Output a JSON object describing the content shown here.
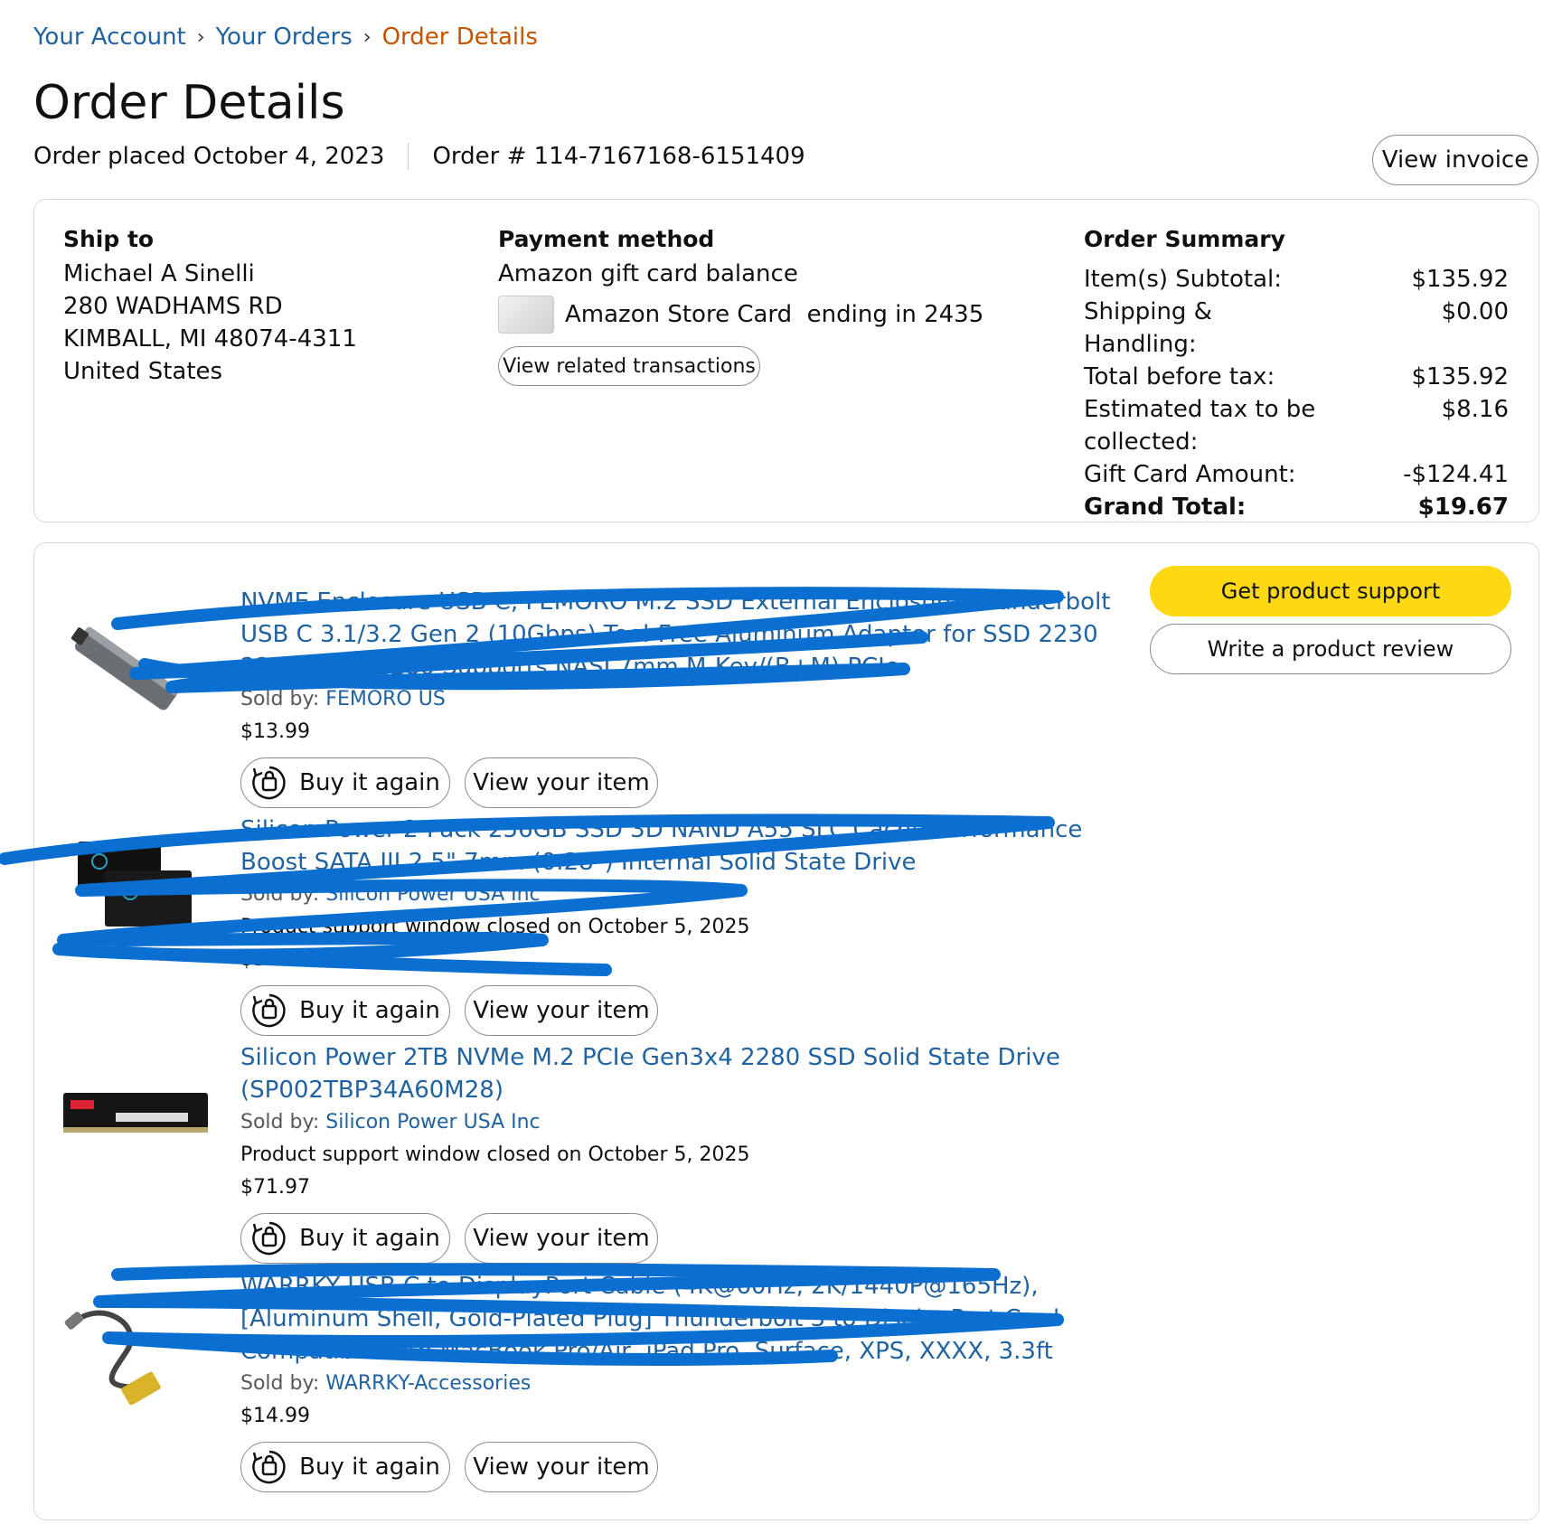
{
  "breadcrumb": {
    "items": [
      "Your Account",
      "Your Orders"
    ],
    "current": "Order Details",
    "separator": "›"
  },
  "page_title": "Order Details",
  "order_meta": {
    "placed": "Order placed October 4, 2023",
    "number": "Order # 114-7167168-6151409"
  },
  "view_invoice_label": "View invoice",
  "ship_to": {
    "heading": "Ship to",
    "lines": [
      "Michael A Sinelli",
      "280 WADHAMS RD",
      "KIMBALL, MI 48074-4311",
      "United States"
    ]
  },
  "payment": {
    "heading": "Payment method",
    "line1": "Amazon gift card balance",
    "card_text": "Amazon Store Card  ending in 2435",
    "related_label": "View related transactions"
  },
  "summary": {
    "heading": "Order Summary",
    "rows": [
      {
        "label": "Item(s) Subtotal:",
        "value": "$135.92"
      },
      {
        "label": "Shipping & Handling:",
        "value": "$0.00"
      },
      {
        "label": "Total before tax:",
        "value": "$135.92"
      },
      {
        "label": "Estimated tax to be collected:",
        "value": "$8.16"
      },
      {
        "label": "Gift Card Amount:",
        "value": "-$124.41"
      }
    ],
    "grand_label": "Grand Total:",
    "grand_value": "$19.67"
  },
  "actions": {
    "support": "Get product support",
    "review": "Write a product review"
  },
  "items": [
    {
      "title": "NVME Enclosure USB C, FEMORO M.2 SSD External Enclosure Thunderbolt USB C 3.1/3.2 Gen 2 (10Gbps) Tool-Free Aluminum Adapter for SSD 2230 2242 2260 2280 Supports NASI 7mm M-Key/(B+M) PCIe",
      "sold_by_label": "Sold by: ",
      "seller": "FEMORO US",
      "support_note": "",
      "price": "$13.99",
      "buy_label": "Buy it again",
      "view_label": "View your item"
    },
    {
      "title": "Silicon Power 2-Pack 256GB SSD 3D NAND A55 SLC Cache Performance Boost SATA III 2.5\" 7mm (0.28\") Internal Solid State Drive",
      "sold_by_label": "Sold by: ",
      "seller": "Silicon Power USA Inc",
      "support_note": "Product support window closed on October 5, 2025",
      "price": "$34.97",
      "buy_label": "Buy it again",
      "view_label": "View your item"
    },
    {
      "title": "Silicon Power 2TB NVMe M.2 PCIe Gen3x4 2280 SSD Solid State Drive (SP002TBP34A60M28)",
      "sold_by_label": "Sold by: ",
      "seller": "Silicon Power USA Inc",
      "support_note": "Product support window closed on October 5, 2025",
      "price": "$71.97",
      "buy_label": "Buy it again",
      "view_label": "View your item"
    },
    {
      "title": "WARRKY USB C to DisplayPort Cable (4K@60Hz, 2K/1440P@165Hz), [Aluminum Shell, Gold-Plated Plug] Thunderbolt 3 to DisplayPort Cord Compatible with MacBook Pro/Air, iPad Pro, Surface, XPS, XXXX, 3.3ft",
      "sold_by_label": "Sold by: ",
      "seller": "WARRKY-Accessories",
      "support_note": "",
      "price": "$14.99",
      "buy_label": "Buy it again",
      "view_label": "View your item"
    }
  ],
  "colors": {
    "link": "#2162a1",
    "current_crumb": "#c45500",
    "yellow": "#ffd814",
    "scribble": "#0a6fd1"
  },
  "icons": {
    "buy_again": "buy-again-icon"
  }
}
